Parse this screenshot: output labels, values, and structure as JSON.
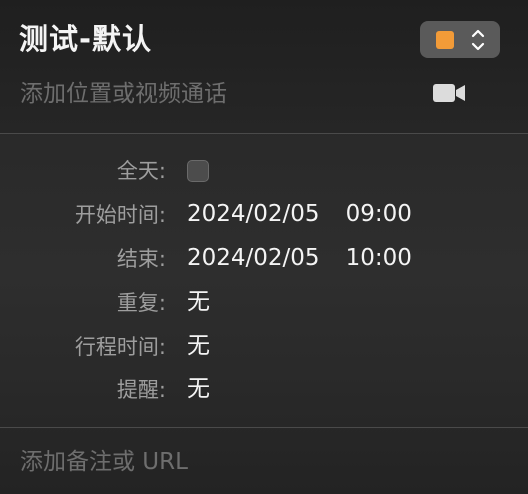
{
  "event": {
    "title": "测试-默认",
    "location_placeholder": "添加位置或视频通话",
    "notes_placeholder": "添加备注或 URL"
  },
  "calendar_color": {
    "swatch": "#f29b38",
    "icon": "chevron-up-down-icon"
  },
  "video_button": {
    "icon": "video-camera-icon"
  },
  "details": {
    "all_day": {
      "label": "全天:",
      "checked": false
    },
    "start": {
      "label": "开始时间:",
      "date": "2024/02/05",
      "time": "09:00"
    },
    "end": {
      "label": "结束:",
      "date": "2024/02/05",
      "time": "10:00"
    },
    "repeat": {
      "label": "重复:",
      "value": "无"
    },
    "travel_time": {
      "label": "行程时间:",
      "value": "无"
    },
    "alert": {
      "label": "提醒:",
      "value": "无"
    }
  }
}
